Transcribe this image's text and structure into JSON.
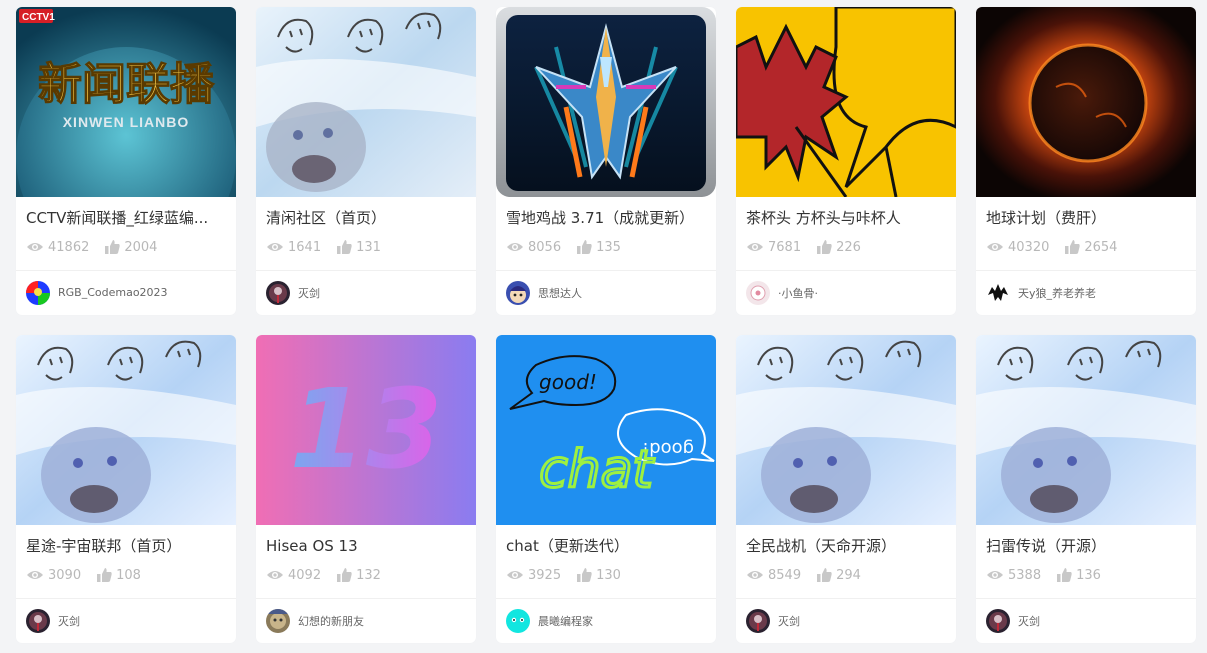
{
  "works": [
    {
      "title": "CCTV新闻联播_红绿蓝编...",
      "views": "41862",
      "likes": "2004",
      "author": "RGB_Codemao2023",
      "cover_icon": "news-broadcast-cover",
      "cover_text": "新闻联播",
      "cover_subtext": "XINWEN LIANBO",
      "cover_badge": "CCTV1",
      "avatar_icon": "rgb-avatar-icon"
    },
    {
      "title": "清闲社区（首页）",
      "views": "1641",
      "likes": "131",
      "author": "灭剑",
      "cover_icon": "meme-cover",
      "avatar_icon": "dark-avatar-icon"
    },
    {
      "title": "雪地鸡战 3.71（成就更新）",
      "views": "8056",
      "likes": "135",
      "author": "思想达人",
      "cover_icon": "jet-fighter-cover",
      "avatar_icon": "cartoon-avatar-icon"
    },
    {
      "title": "茶杯头 方杯头与咔杯人",
      "views": "7681",
      "likes": "226",
      "author": "·小鱼骨·",
      "cover_icon": "leaves-cover",
      "avatar_icon": "light-avatar-icon"
    },
    {
      "title": "地球计划（费肝）",
      "views": "40320",
      "likes": "2654",
      "author": "天y狼_养老养老",
      "cover_icon": "burning-planet-cover",
      "avatar_icon": "wolf-avatar-icon"
    },
    {
      "title": "星途-宇宙联邦（首页）",
      "views": "3090",
      "likes": "108",
      "author": "灭剑",
      "cover_icon": "meme-cover",
      "avatar_icon": "dark-avatar-icon"
    },
    {
      "title": "Hisea OS 13",
      "views": "4092",
      "likes": "132",
      "author": "幻想的新朋友",
      "cover_icon": "os13-cover",
      "cover_text": "13",
      "avatar_icon": "photo-avatar-icon"
    },
    {
      "title": "chat（更新迭代）",
      "views": "3925",
      "likes": "130",
      "author": "晨曦编程家",
      "cover_icon": "chat-cover",
      "cover_text": "chat",
      "cover_bubble1": "good!",
      "cover_bubble2": "good!",
      "avatar_icon": "cyan-avatar-icon"
    },
    {
      "title": "全民战机（天命开源）",
      "views": "8549",
      "likes": "294",
      "author": "灭剑",
      "cover_icon": "meme-cover",
      "avatar_icon": "dark-avatar-icon"
    },
    {
      "title": "扫雷传说（开源）",
      "views": "5388",
      "likes": "136",
      "author": "灭剑",
      "cover_icon": "meme-cover",
      "avatar_icon": "dark-avatar-icon"
    }
  ],
  "colors": {
    "background": "#f3f4f6",
    "stat_gray": "#b8b8b8",
    "leaf_red": "#b3262a",
    "leaf_yellow": "#f8c300",
    "chat_blue": "#1f8ff0",
    "os_pink": "#f06eb4",
    "os_violet": "#8a7cf0"
  }
}
